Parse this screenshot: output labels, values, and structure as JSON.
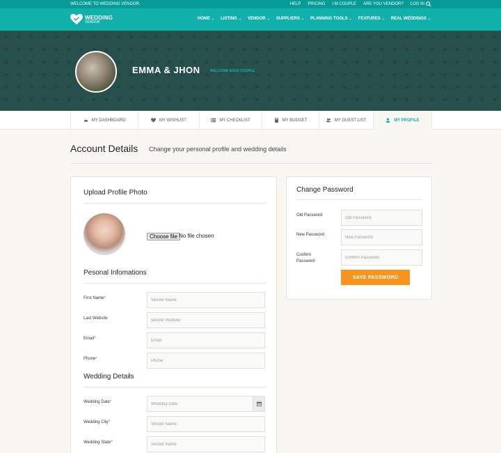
{
  "topbar": {
    "welcome": "WELCOME TO WEDDING VENDOR.",
    "links": [
      "HELP",
      "PRICING",
      "I M COUPLE",
      "ARE YOU VENDOR?",
      "LOG IN"
    ]
  },
  "logo": {
    "line1": "WEDDING",
    "line2": "VENDOR"
  },
  "menu": [
    {
      "label": "HOME"
    },
    {
      "label": "LISTING"
    },
    {
      "label": "VENDOR"
    },
    {
      "label": "SUPPLIERS"
    },
    {
      "label": "PLANNING TOOLS"
    },
    {
      "label": "FEATURES"
    },
    {
      "label": "REAL WEDDINGS"
    }
  ],
  "hero": {
    "name": "EMMA & JHON",
    "subtitle": "WELCOME BACK COUPLE"
  },
  "tabs": [
    {
      "label": "MY DASHBOARD",
      "icon": "dashboard-icon"
    },
    {
      "label": "MY WISHLIST",
      "icon": "heart-icon"
    },
    {
      "label": "MY CHECKLIST",
      "icon": "list-icon"
    },
    {
      "label": "MY BUDGET",
      "icon": "calculator-icon"
    },
    {
      "label": "MY GUEST LIST",
      "icon": "users-icon"
    },
    {
      "label": "MY PROFILE",
      "icon": "user-icon"
    }
  ],
  "account": {
    "title": "Account Details",
    "subtitle": "Change your personal profile and wedding details"
  },
  "upload": {
    "title": "Upload Profile Photo",
    "button": "Choose file",
    "status": "No file chosen"
  },
  "personal": {
    "title": "Pesonal Infomations",
    "fields": [
      {
        "label": "First Name",
        "required": "*",
        "placeholder": "Vendor Name"
      },
      {
        "label": "Last Website",
        "required": "",
        "placeholder": "Vendor Website"
      },
      {
        "label": "Email",
        "required": "*",
        "placeholder": "Email"
      },
      {
        "label": "Phone",
        "required": "*",
        "placeholder": "Phone"
      }
    ]
  },
  "wedding": {
    "title": "Wedding Details",
    "fields": [
      {
        "label": "Wedding Date",
        "required": "*",
        "placeholder": "Wedding Date"
      },
      {
        "label": "Wedding City",
        "required": "*",
        "placeholder": "Vendor Name"
      },
      {
        "label": "Wedding State",
        "required": "*",
        "placeholder": "Vendor Name"
      }
    ]
  },
  "password": {
    "title": "Change Password",
    "fields": [
      {
        "label": "Old Password",
        "placeholder": "Old Password"
      },
      {
        "label": "New Password",
        "placeholder": "New Password"
      },
      {
        "label": "Confirm Password",
        "placeholder": "Confirm Password"
      }
    ],
    "button": "SAVE PASSWORD"
  },
  "colors": {
    "teal": "#12b0ab",
    "dark_teal": "#069b97",
    "hero_bg": "#27504d",
    "orange": "#f7941d",
    "required": "#e53b3b"
  }
}
